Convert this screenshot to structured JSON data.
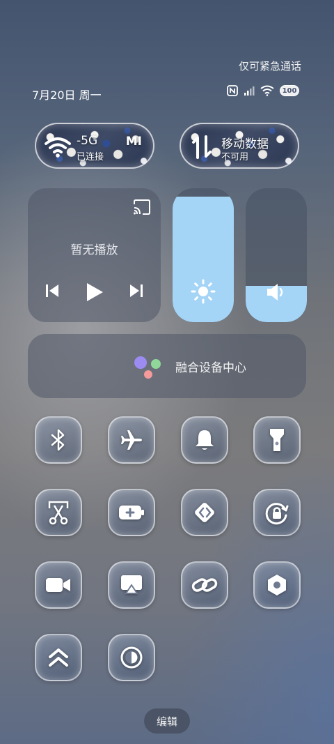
{
  "status_bar": {
    "emergency_text": "仅可紧急通话",
    "date_text": "7月20日 周一",
    "battery_level": "100"
  },
  "wifi_tile": {
    "name": "-5G",
    "status": "已连接",
    "badge": "MI",
    "icon": "wifi-icon"
  },
  "data_tile": {
    "name": "移动数据",
    "status": "不可用",
    "icon": "mobile-data-icon"
  },
  "media": {
    "now_playing": "暂无播放"
  },
  "sliders": {
    "brightness_level": 0.94,
    "volume_level": 0.27
  },
  "fusion_center": {
    "label": "融合设备中心"
  },
  "toggles": [
    {
      "icon": "bluetooth-icon",
      "active": true
    },
    {
      "icon": "airplane-icon",
      "active": false
    },
    {
      "icon": "bell-icon",
      "active": false
    },
    {
      "icon": "flashlight-icon",
      "active": false
    },
    {
      "icon": "screenshot-scissors-icon",
      "active": false
    },
    {
      "icon": "battery-saver-icon",
      "active": false
    },
    {
      "icon": "code-icon",
      "active": false
    },
    {
      "icon": "rotation-lock-icon",
      "active": true
    },
    {
      "icon": "video-camera-icon",
      "active": false
    },
    {
      "icon": "screen-cast-icon",
      "active": false
    },
    {
      "icon": "link-icon",
      "active": false
    },
    {
      "icon": "hexagon-settings-icon",
      "active": false
    },
    {
      "icon": "chevrons-up-icon",
      "active": true
    },
    {
      "icon": "dark-mode-icon",
      "active": false
    }
  ],
  "footer": {
    "edit_label": "编辑"
  }
}
